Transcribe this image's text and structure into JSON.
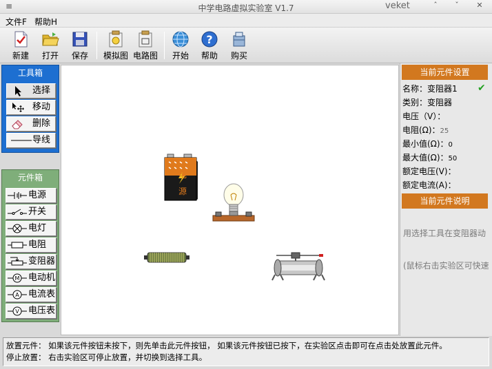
{
  "window": {
    "app_icon": "≡",
    "title": "中学电路虚拟实验室 V1.7",
    "brand": "veket",
    "minimize": "ˆ",
    "maximize": "ˇ",
    "close": "✕"
  },
  "menu": {
    "file": "文件F",
    "help": "帮助H"
  },
  "toolbar": {
    "new": "新建",
    "open": "打开",
    "save": "保存",
    "simulation": "模拟图",
    "circuit": "电路图",
    "start": "开始",
    "help": "帮助",
    "buy": "购买"
  },
  "toolbox": {
    "title": "工具箱",
    "items": [
      {
        "label": "选择",
        "icon": "cursor-icon"
      },
      {
        "label": "移动",
        "icon": "move-icon"
      },
      {
        "label": "删除",
        "icon": "eraser-icon"
      },
      {
        "label": "导线",
        "icon": "wire-icon"
      }
    ]
  },
  "components": {
    "title": "元件箱",
    "items": [
      {
        "label": "电源",
        "icon": "battery-symbol-icon"
      },
      {
        "label": "开关",
        "icon": "switch-symbol-icon"
      },
      {
        "label": "电灯",
        "icon": "lamp-symbol-icon"
      },
      {
        "label": "电阻",
        "icon": "resistor-symbol-icon"
      },
      {
        "label": "变阻器",
        "icon": "rheostat-symbol-icon"
      },
      {
        "label": "电动机",
        "icon": "motor-symbol-icon"
      },
      {
        "label": "电流表",
        "icon": "ammeter-symbol-icon"
      },
      {
        "label": "电压表",
        "icon": "voltmeter-symbol-icon"
      }
    ]
  },
  "canvas": {
    "battery_text_1": "电",
    "battery_text_2": "源"
  },
  "settings": {
    "title": "当前元件设置",
    "name_label": "名称：",
    "name_value": "变阻器1",
    "type_label": "类别：",
    "type_value": "变阻器",
    "voltage_label": "电压（V）：",
    "resistance_label": "电阻(Ω)：",
    "resistance_value": "25",
    "min_label": "最小值(Ω)：",
    "min_value": "0",
    "max_label": "最大值(Ω)：",
    "max_value": "50",
    "rated_voltage_label": "额定电压(V)：",
    "rated_current_label": "额定电流(A)：",
    "ok_icon": "✔"
  },
  "description": {
    "title": "当前元件说明",
    "line1": "用选择工具在变阻器动",
    "line2": "(鼠标右击实验区可快速"
  },
  "status": {
    "line1": "放置元件： 如果该元件按钮未按下，则先单击此元件按钮， 如果该元件按钮已按下，在实验区点击即可在点击处放置此元件。",
    "line2": "停止放置： 右击实验区可停止放置，并切换到选择工具。"
  },
  "colors": {
    "toolbox_bg": "#1d6fd1",
    "components_bg": "#7fae7a",
    "panel_header": "#d2781f",
    "check": "#22a022"
  }
}
